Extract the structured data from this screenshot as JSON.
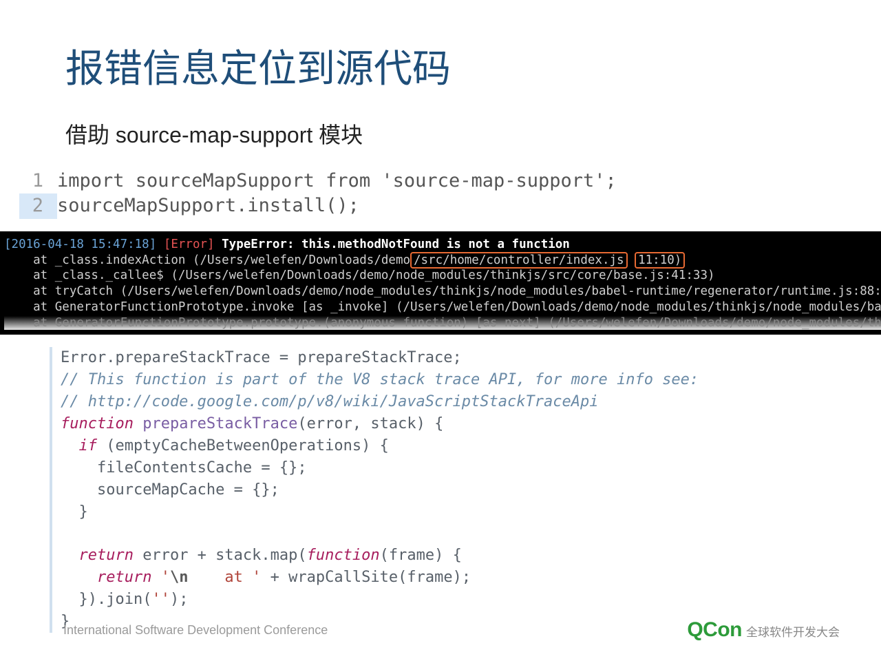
{
  "title": "报错信息定位到源代码",
  "subtitle": "借助 source-map-support 模块",
  "import_code": {
    "line1_num": "1",
    "line1": "import sourceMapSupport from 'source-map-support';",
    "line2_num": "2",
    "line2": "sourceMapSupport.install();"
  },
  "terminal": {
    "timestamp": "[2016-04-18 15:47:18]",
    "error_tag": "[Error]",
    "error_msg": "TypeError: this.methodNotFound is not a function",
    "line1_pre": "    at _class.indexAction (/Users/welefen/Downloads/demo",
    "hl1": "/src/home/controller/index.js",
    "hl2": "11:10)",
    "line2": "    at _class._callee$ (/Users/welefen/Downloads/demo/node_modules/thinkjs/src/core/base.js:41:33)",
    "line3": "    at tryCatch (/Users/welefen/Downloads/demo/node_modules/thinkjs/node_modules/babel-runtime/regenerator/runtime.js:88:",
    "line4": "    at GeneratorFunctionPrototype.invoke [as _invoke] (/Users/welefen/Downloads/demo/node_modules/thinkjs/node_modules/ba",
    "line5": "    at GeneratorFunctionPrototype.prototype.(anonymous function) [as next] (/Users/welefen/Downloads/demo/node_modules/th"
  },
  "code": {
    "l1a": "Error.prepareStackTrace = prepareStackTrace;",
    "l2": "// This function is part of the V8 stack trace API, for more info see:",
    "l3": "// http://code.google.com/p/v8/wiki/JavaScriptStackTraceApi",
    "l4_kw": "function",
    "l4_fn": " prepareStackTrace",
    "l4_rest": "(error, stack) {",
    "l5_kw": "  if",
    "l5_rest": " (emptyCacheBetweenOperations) {",
    "l6": "    fileContentsCache = {};",
    "l7": "    sourceMapCache = {};",
    "l8": "  }",
    "l9": "",
    "l10_kw": "  return",
    "l10_mid": " error + stack.map(",
    "l10_fn": "function",
    "l10_rest": "(frame) {",
    "l11_kw": "    return",
    "l11_sp": " ",
    "l11_q1": "'",
    "l11_esc": "\\n",
    "l11_str": "    at ",
    "l11_q2": "'",
    "l11_rest": " + wrapCallSite(frame);",
    "l12": "  }).join(",
    "l12_str": "''",
    "l12_end": ");",
    "l13": "}"
  },
  "footer": {
    "left": "International Software Development Conference",
    "brand": "QCon",
    "brand_sub": "全球软件开发大会"
  }
}
